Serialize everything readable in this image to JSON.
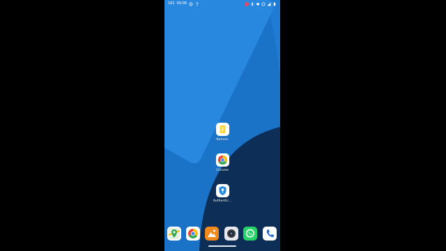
{
  "statusbar": {
    "time": "09:08",
    "left_extra": "161",
    "icons_left": [
      "whatsapp-icon",
      "wifi-calling-icon"
    ],
    "icons_right": [
      "screen-record-icon",
      "bluetooth-icon",
      "wifi-icon",
      "data-saver-icon",
      "signal-icon",
      "battery-icon"
    ]
  },
  "colors": {
    "wallpaper_light": "#2a8ae0",
    "wallpaper_mid": "#1b73c8",
    "wallpaper_dark": "#0d2f57",
    "notes_yellow": "#fcd535",
    "whatsapp_green": "#25d366",
    "gallery_orange": "#f08a1c",
    "phone_blue": "#1a6ad8"
  },
  "home_apps": [
    {
      "label": "Notizen",
      "icon": "notes-icon"
    },
    {
      "label": "Chrome",
      "icon": "chrome-icon"
    },
    {
      "label": "Authentic...",
      "icon": "authenticator-icon"
    }
  ],
  "dock": [
    {
      "icon": "maps-icon"
    },
    {
      "icon": "chrome-icon"
    },
    {
      "icon": "gallery-icon"
    },
    {
      "icon": "camera-icon"
    },
    {
      "icon": "whatsapp-icon"
    },
    {
      "icon": "phone-icon"
    }
  ]
}
